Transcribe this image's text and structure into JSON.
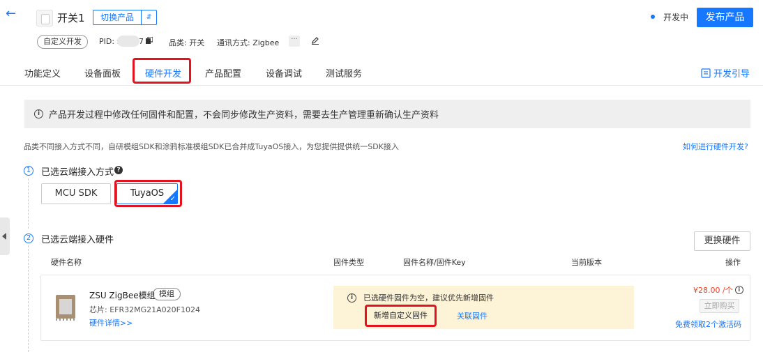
{
  "header": {
    "back_icon": "arrow-left-icon",
    "product_name": "开关1",
    "switch_product": "切换产品",
    "status": "开发中",
    "publish": "发布产品",
    "tag_custom": "自定义开发",
    "pid_label": "PID: f",
    "pid_suffix": "7",
    "category": "品类: 开关",
    "protocol": "通讯方式: Zigbee",
    "more": "···"
  },
  "tabs": [
    {
      "label": "功能定义"
    },
    {
      "label": "设备面板"
    },
    {
      "label": "硬件开发"
    },
    {
      "label": "产品配置"
    },
    {
      "label": "设备调试"
    },
    {
      "label": "测试服务"
    }
  ],
  "active_tab": "硬件开发",
  "guide_label": "开发引导",
  "notice": "产品开发过程中修改任何固件和配置，不会同步修改生产资料，需要去生产管理重新确认生产资料",
  "description": "品类不同接入方式不同，自研模组SDK和涂鸦标准模组SDK已合并成TuyaOS接入，为您提供提供统一SDK接入",
  "how_link": "如何进行硬件开发?",
  "step1": {
    "num": "1",
    "title": "已选云端接入方式",
    "options": [
      "MCU SDK",
      "TuyaOS"
    ],
    "selected": "TuyaOS"
  },
  "step2": {
    "num": "2",
    "title": "已选云端接入硬件",
    "change_button": "更换硬件"
  },
  "table": {
    "headers": [
      "硬件名称",
      "固件类型",
      "固件名称/固件Key",
      "当前版本",
      "操作"
    ],
    "row": {
      "name": "ZSU ZigBee模组",
      "tag": "模组",
      "chip": "芯片: EFR32MG21A020F1024",
      "detail_link": "硬件详情>>",
      "firmware_notice": "已选硬件固件为空，建议优先新增固件",
      "add_firmware": "新增自定义固件",
      "link_firmware": "关联固件",
      "price": "¥28.00 /个",
      "buy": "立即购买",
      "free_codes": "免费领取2个激活码"
    }
  },
  "colors": {
    "accent": "#1677ff",
    "annotation": "#e3121f",
    "price": "#f5401d"
  }
}
